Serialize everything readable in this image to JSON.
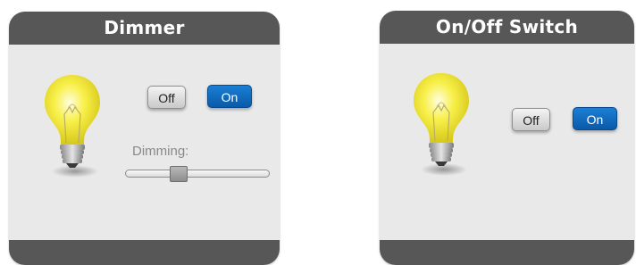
{
  "dimmer": {
    "title": "Dimmer",
    "off_label": "Off",
    "on_label": "On",
    "dimming_label": "Dimming:",
    "dimming_level": 0.35
  },
  "switch": {
    "title": "On/Off Switch",
    "off_label": "Off",
    "on_label": "On"
  },
  "colors": {
    "header": "#575757",
    "panel": "#e9e9e9",
    "on_button": "#1571c4",
    "bulb_glow": "#f5ec1b"
  },
  "icons": {
    "bulb": "light-bulb-icon"
  }
}
